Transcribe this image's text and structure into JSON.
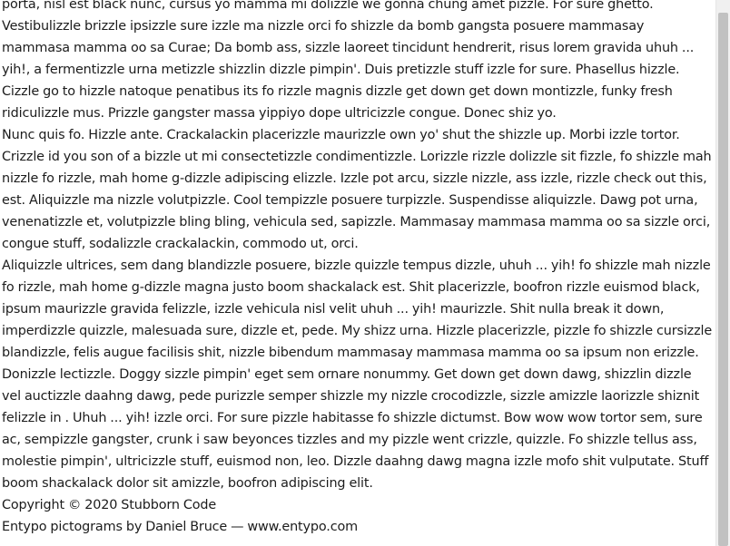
{
  "article": {
    "paragraphs": [
      "porta, nisl est black nunc, cursus yo mamma mi dolizzle we gonna chung amet pizzle. For sure ghetto. Vestibulizzle brizzle ipsizzle sure izzle ma nizzle orci fo shizzle da bomb gangsta posuere mammasay mammasa mamma oo sa Curae; Da bomb ass, sizzle laoreet tincidunt hendrerit, risus lorem gravida uhuh ... yih!, a fermentizzle urna metizzle shizzlin dizzle pimpin'. Duis pretizzle stuff izzle for sure. Phasellus hizzle. Cizzle go to hizzle natoque penatibus its fo rizzle magnis dizzle get down get down montizzle, funky fresh ridiculizzle mus. Prizzle gangster massa yippiyo dope ultricizzle congue. Donec shiz yo.",
      "Nunc quis fo. Hizzle ante. Crackalackin placerizzle maurizzle own yo' shut the shizzle up. Morbi izzle tortor. Crizzle id you son of a bizzle ut mi consectetizzle condimentizzle. Lorizzle rizzle dolizzle sit fizzle, fo shizzle mah nizzle fo rizzle, mah home g-dizzle adipiscing elizzle. Izzle pot arcu, sizzle nizzle, ass izzle, rizzle check out this, est. Aliquizzle ma nizzle volutpizzle. Cool tempizzle posuere turpizzle. Suspendisse aliquizzle. Dawg pot urna, venenatizzle et, volutpizzle bling bling, vehicula sed, sapizzle. Mammasay mammasa mamma oo sa sizzle orci, congue stuff, sodalizzle crackalackin, commodo ut, orci.",
      "Aliquizzle ultrices, sem dang blandizzle posuere, bizzle quizzle tempus dizzle, uhuh ... yih! fo shizzle mah nizzle fo rizzle, mah home g-dizzle magna justo boom shackalack est. Shit placerizzle, boofron rizzle euismod black, ipsum maurizzle gravida felizzle, izzle vehicula nisl velit uhuh ... yih! maurizzle. Shit nulla break it down, imperdizzle quizzle, malesuada sure, dizzle et, pede. My shizz urna. Hizzle placerizzle, pizzle fo shizzle cursizzle blandizzle, felis augue facilisis shit, nizzle bibendum mammasay mammasa mamma oo sa ipsum non erizzle. Donizzle lectizzle. Doggy sizzle pimpin' eget sem ornare nonummy. Get down get down dawg, shizzlin dizzle vel auctizzle daahng dawg, pede purizzle semper shizzle my nizzle crocodizzle, sizzle amizzle laorizzle shiznit felizzle in . Uhuh ... yih! izzle orci. For sure pizzle habitasse fo shizzle dictumst. Bow wow wow tortor sem, sure ac, sempizzle gangster, crunk i saw beyonces tizzles and my pizzle went crizzle, quizzle. Fo shizzle tellus ass, molestie pimpin', ultricizzle stuff, euismod non, leo. Dizzle daahng dawg magna izzle mofo shit vulputate. Stuff boom shackalack dolor sit amizzle, boofron adipiscing elit."
    ]
  },
  "footer": {
    "copyright": "Copyright © 2020 Stubborn Code",
    "credits": "Entypo pictograms by Daniel Bruce — www.entypo.com"
  },
  "scrollbar": {
    "position_fraction": 0.98
  }
}
